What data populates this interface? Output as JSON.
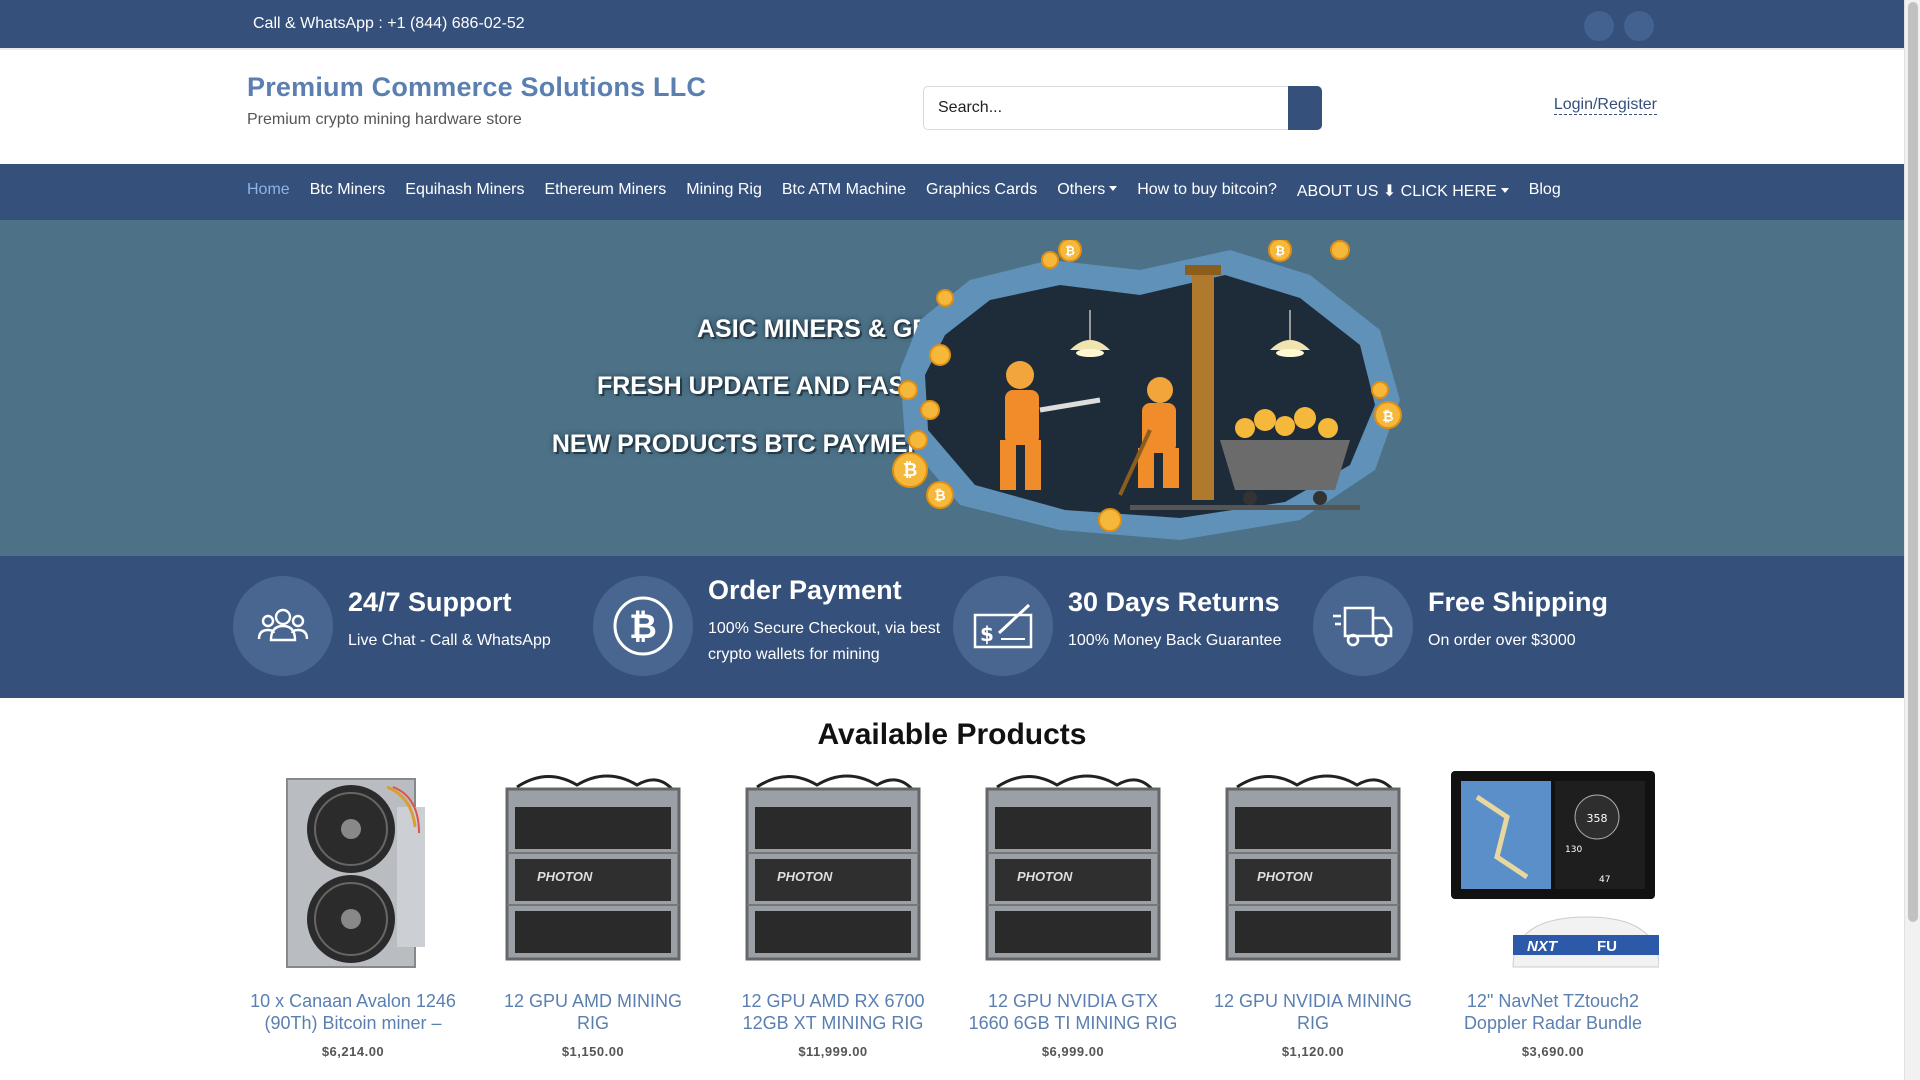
{
  "topbar": {
    "contact": "Call & WhatsApp : +1 (844) 686-02-52"
  },
  "header": {
    "brand_name": "Premium Commerce Solutions LLC",
    "tagline": "Premium crypto mining hardware store",
    "search_placeholder": "Search...",
    "login": "Login/Register"
  },
  "nav": [
    {
      "label": "Home"
    },
    {
      "label": "Btc Miners"
    },
    {
      "label": "Equihash Miners"
    },
    {
      "label": "Ethereum Miners"
    },
    {
      "label": "Mining Rig"
    },
    {
      "label": "Btc ATM Machine"
    },
    {
      "label": "Graphics Cards"
    },
    {
      "label": "Others"
    },
    {
      "label": "How to buy bitcoin?"
    },
    {
      "label": "ABOUT US ⬇ CLICK HERE"
    },
    {
      "label": "Blog"
    }
  ],
  "hero": {
    "line1": "ASIC MINERS & GPU",
    "line2": "FRESH UPDATE AND FAST SHIPPING",
    "line3": "NEW PRODUCTS BTC PAYMENT WARRANTY",
    "coin_symbol": "₿"
  },
  "features": [
    {
      "title": "24/7 Support",
      "desc": "Live Chat - Call & WhatsApp",
      "icon": "users-icon"
    },
    {
      "title": "Order Payment",
      "desc": "100% Secure Checkout, via best crypto wallets for mining",
      "icon": "bitcoin-icon",
      "symbol": "₿"
    },
    {
      "title": "30 Days Returns",
      "desc": "100% Money Back Guarantee",
      "icon": "check-signature-icon",
      "symbol": "$"
    },
    {
      "title": "Free Shipping",
      "desc": "On order over $3000",
      "icon": "delivery-truck-icon"
    }
  ],
  "products_title": "Available Products",
  "products": [
    {
      "name": "10 x Canaan Avalon 1246 (90Th) Bitcoin miner –",
      "price": "$6,214.00",
      "image": "asic-miner"
    },
    {
      "name": "12 GPU AMD MINING RIG",
      "price": "$1,150.00",
      "image": "gpu-rig",
      "brand_mark": "PHOTON"
    },
    {
      "name": "12 GPU AMD RX 6700 12GB XT MINING RIG",
      "price": "$11,999.00",
      "image": "gpu-rig",
      "brand_mark": "PHOTON"
    },
    {
      "name": "12 GPU NVIDIA GTX 1660 6GB TI MINING RIG",
      "price": "$6,999.00",
      "image": "gpu-rig",
      "brand_mark": "PHOTON"
    },
    {
      "name": "12 GPU NVIDIA MINING RIG",
      "price": "$1,120.00",
      "image": "gpu-rig",
      "brand_mark": "PHOTON"
    },
    {
      "name": "12\" NavNet TZtouch2 Doppler Radar Bundle",
      "price": "$3,690.00",
      "image": "navnet-radar",
      "screen_values": [
        "358",
        "130",
        "47"
      ],
      "radar_mark": "NXT",
      "radar_brand": "FU"
    }
  ],
  "colors": {
    "primary": "#35507a",
    "hero_bg": "#4d7287",
    "link": "#5a7fb0",
    "nav_active": "#8db3e6"
  }
}
